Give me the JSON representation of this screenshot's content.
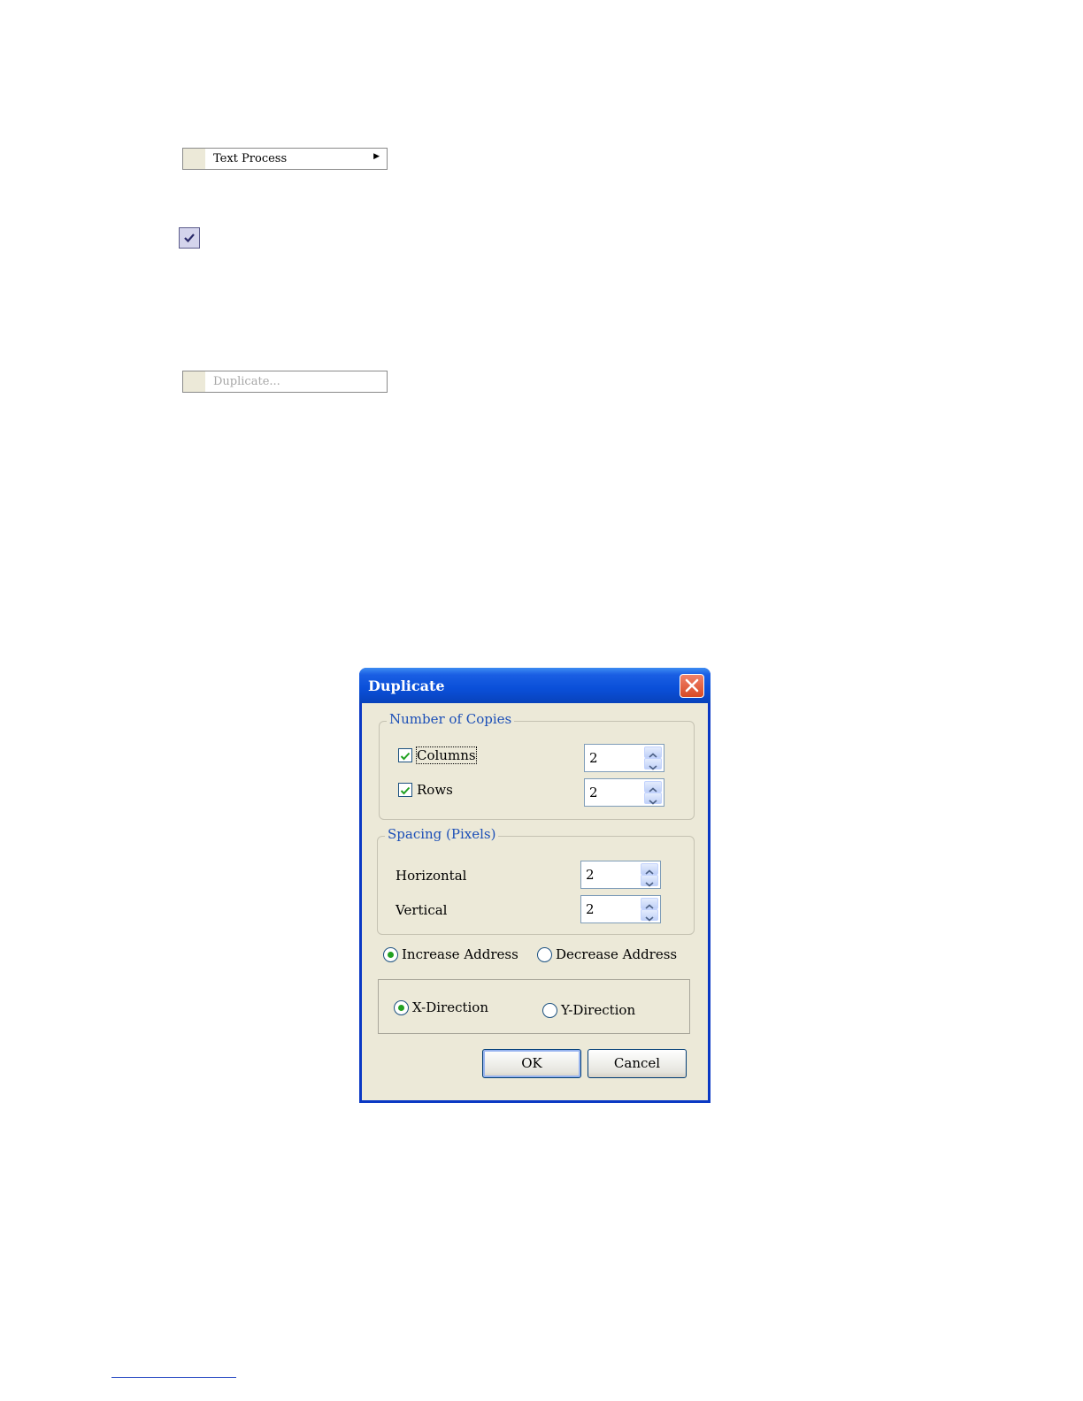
{
  "menu": {
    "text_process_label": "Text Process",
    "duplicate_label": "Duplicate..."
  },
  "dialog": {
    "title": "Duplicate",
    "number_of_copies": {
      "legend": "Number of Copies",
      "columns_label": "Columns",
      "columns_checked": true,
      "columns_value": "2",
      "rows_label": "Rows",
      "rows_checked": true,
      "rows_value": "2"
    },
    "spacing": {
      "legend": "Spacing (Pixels)",
      "horizontal_label": "Horizontal",
      "horizontal_value": "2",
      "vertical_label": "Vertical",
      "vertical_value": "2"
    },
    "address": {
      "increase_label": "Increase Address",
      "decrease_label": "Decrease Address",
      "selected": "increase"
    },
    "direction": {
      "x_label": "X-Direction",
      "y_label": "Y-Direction",
      "selected": "x"
    },
    "ok_label": "OK",
    "cancel_label": "Cancel"
  }
}
